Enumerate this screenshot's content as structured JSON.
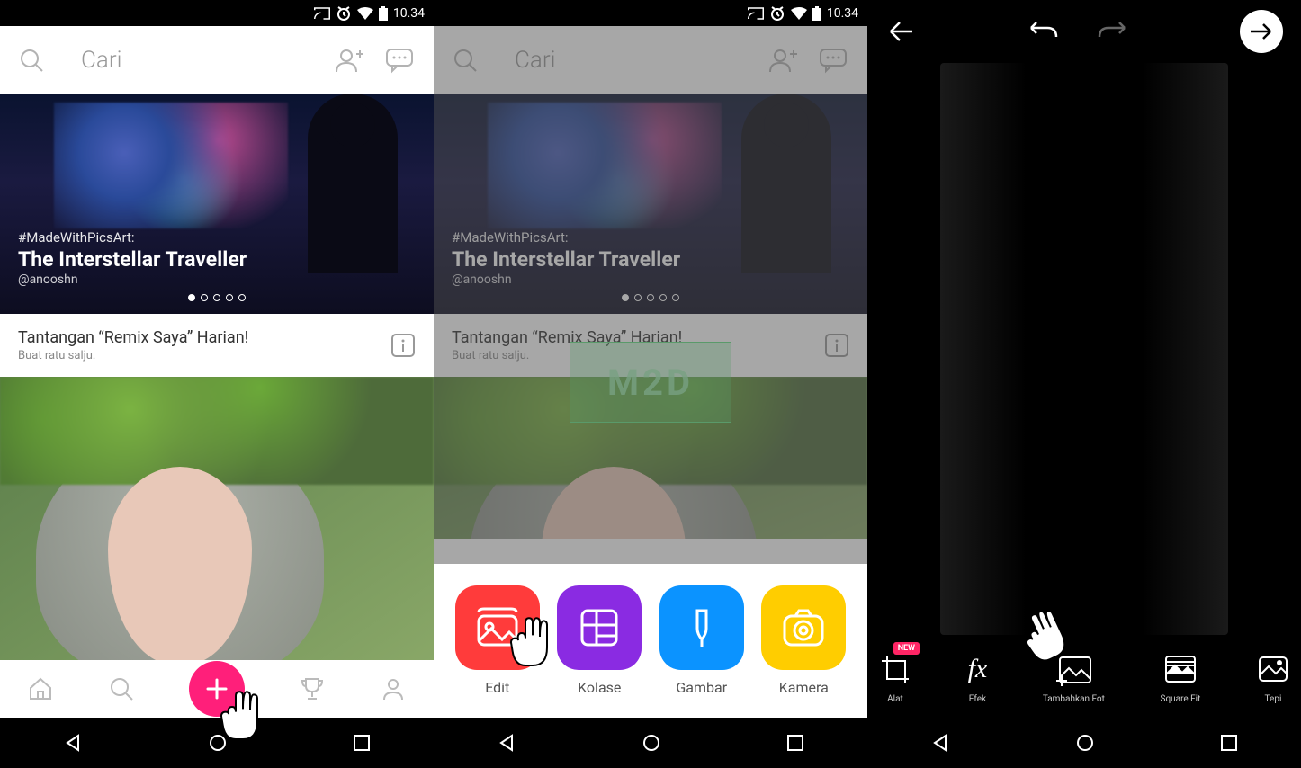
{
  "status": {
    "time": "10.34"
  },
  "header": {
    "search_placeholder": "Cari"
  },
  "banner": {
    "hashtag": "#MadeWithPicsArt:",
    "title": "The Interstellar Traveller",
    "author": "@anooshn",
    "dot_count": 5,
    "active_dot": 0
  },
  "challenge": {
    "title": "Tantangan “Remix Saya” Harian!",
    "subtitle": "Buat ratu salju."
  },
  "watermark": "M2D",
  "menu": {
    "edit": "Edit",
    "kolase": "Kolase",
    "gambar": "Gambar",
    "kamera": "Kamera"
  },
  "editor": {
    "tools": {
      "alat": "Alat",
      "efek": "Efek",
      "tambahkan": "Tambahkan Fot",
      "square": "Square Fit",
      "tepi": "Tepi",
      "new_badge": "NEW"
    }
  },
  "colors": {
    "fab": "#ff1f7a",
    "edit": "#ff3b3b",
    "kolase": "#8a2be2",
    "gambar": "#0b93ff",
    "kamera": "#ffcd00"
  }
}
